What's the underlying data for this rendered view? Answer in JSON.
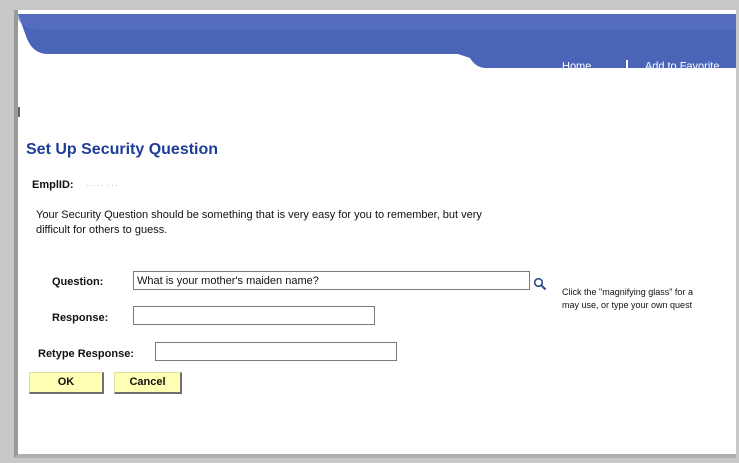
{
  "nav": {
    "home": "Home",
    "favorites": "Add to Favorite"
  },
  "page": {
    "title": "Set Up Security Question",
    "emplid_label": "EmplID:",
    "emplid_value": "····· ···",
    "description": "Your Security Question should be something that is very easy for you to remember, but very difficult for others to guess."
  },
  "form": {
    "question_label": "Question:",
    "question_value": "What is your mother's maiden name?",
    "response_label": "Response:",
    "response_value": "",
    "retype_label": "Retype Response:",
    "retype_value": "",
    "hint_line1": "Click the \"magnifying glass\" for a",
    "hint_line2": "may use, or type your own quest"
  },
  "buttons": {
    "ok": "OK",
    "cancel": "Cancel"
  },
  "colors": {
    "header_blue": "#4a64b8",
    "title_blue": "#1e3d96",
    "button_yellow": "#ffffb4"
  },
  "icons": {
    "lookup": "magnifying-glass-icon"
  }
}
